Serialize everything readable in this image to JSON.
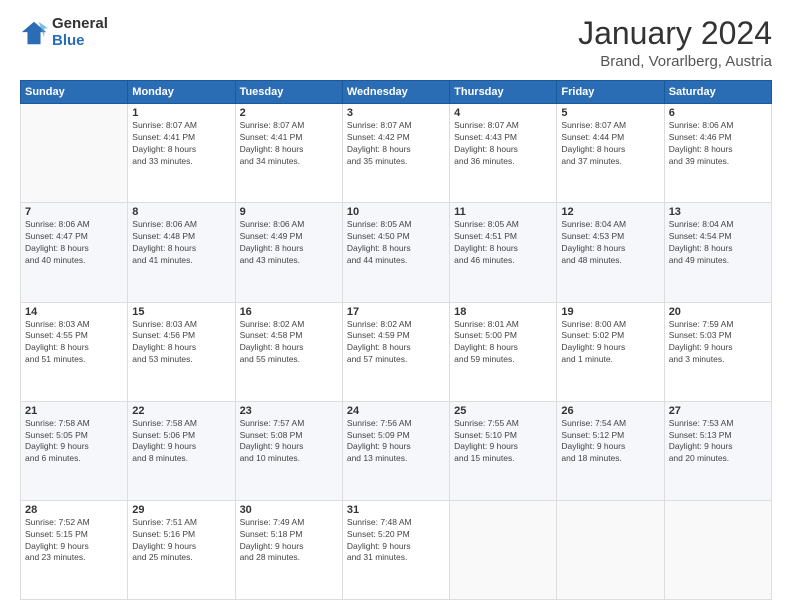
{
  "logo": {
    "general": "General",
    "blue": "Blue"
  },
  "header": {
    "month": "January 2024",
    "location": "Brand, Vorarlberg, Austria"
  },
  "weekdays": [
    "Sunday",
    "Monday",
    "Tuesday",
    "Wednesday",
    "Thursday",
    "Friday",
    "Saturday"
  ],
  "weeks": [
    [
      {
        "day": "",
        "info": ""
      },
      {
        "day": "1",
        "info": "Sunrise: 8:07 AM\nSunset: 4:41 PM\nDaylight: 8 hours\nand 33 minutes."
      },
      {
        "day": "2",
        "info": "Sunrise: 8:07 AM\nSunset: 4:41 PM\nDaylight: 8 hours\nand 34 minutes."
      },
      {
        "day": "3",
        "info": "Sunrise: 8:07 AM\nSunset: 4:42 PM\nDaylight: 8 hours\nand 35 minutes."
      },
      {
        "day": "4",
        "info": "Sunrise: 8:07 AM\nSunset: 4:43 PM\nDaylight: 8 hours\nand 36 minutes."
      },
      {
        "day": "5",
        "info": "Sunrise: 8:07 AM\nSunset: 4:44 PM\nDaylight: 8 hours\nand 37 minutes."
      },
      {
        "day": "6",
        "info": "Sunrise: 8:06 AM\nSunset: 4:46 PM\nDaylight: 8 hours\nand 39 minutes."
      }
    ],
    [
      {
        "day": "7",
        "info": "Sunrise: 8:06 AM\nSunset: 4:47 PM\nDaylight: 8 hours\nand 40 minutes."
      },
      {
        "day": "8",
        "info": "Sunrise: 8:06 AM\nSunset: 4:48 PM\nDaylight: 8 hours\nand 41 minutes."
      },
      {
        "day": "9",
        "info": "Sunrise: 8:06 AM\nSunset: 4:49 PM\nDaylight: 8 hours\nand 43 minutes."
      },
      {
        "day": "10",
        "info": "Sunrise: 8:05 AM\nSunset: 4:50 PM\nDaylight: 8 hours\nand 44 minutes."
      },
      {
        "day": "11",
        "info": "Sunrise: 8:05 AM\nSunset: 4:51 PM\nDaylight: 8 hours\nand 46 minutes."
      },
      {
        "day": "12",
        "info": "Sunrise: 8:04 AM\nSunset: 4:53 PM\nDaylight: 8 hours\nand 48 minutes."
      },
      {
        "day": "13",
        "info": "Sunrise: 8:04 AM\nSunset: 4:54 PM\nDaylight: 8 hours\nand 49 minutes."
      }
    ],
    [
      {
        "day": "14",
        "info": "Sunrise: 8:03 AM\nSunset: 4:55 PM\nDaylight: 8 hours\nand 51 minutes."
      },
      {
        "day": "15",
        "info": "Sunrise: 8:03 AM\nSunset: 4:56 PM\nDaylight: 8 hours\nand 53 minutes."
      },
      {
        "day": "16",
        "info": "Sunrise: 8:02 AM\nSunset: 4:58 PM\nDaylight: 8 hours\nand 55 minutes."
      },
      {
        "day": "17",
        "info": "Sunrise: 8:02 AM\nSunset: 4:59 PM\nDaylight: 8 hours\nand 57 minutes."
      },
      {
        "day": "18",
        "info": "Sunrise: 8:01 AM\nSunset: 5:00 PM\nDaylight: 8 hours\nand 59 minutes."
      },
      {
        "day": "19",
        "info": "Sunrise: 8:00 AM\nSunset: 5:02 PM\nDaylight: 9 hours\nand 1 minute."
      },
      {
        "day": "20",
        "info": "Sunrise: 7:59 AM\nSunset: 5:03 PM\nDaylight: 9 hours\nand 3 minutes."
      }
    ],
    [
      {
        "day": "21",
        "info": "Sunrise: 7:58 AM\nSunset: 5:05 PM\nDaylight: 9 hours\nand 6 minutes."
      },
      {
        "day": "22",
        "info": "Sunrise: 7:58 AM\nSunset: 5:06 PM\nDaylight: 9 hours\nand 8 minutes."
      },
      {
        "day": "23",
        "info": "Sunrise: 7:57 AM\nSunset: 5:08 PM\nDaylight: 9 hours\nand 10 minutes."
      },
      {
        "day": "24",
        "info": "Sunrise: 7:56 AM\nSunset: 5:09 PM\nDaylight: 9 hours\nand 13 minutes."
      },
      {
        "day": "25",
        "info": "Sunrise: 7:55 AM\nSunset: 5:10 PM\nDaylight: 9 hours\nand 15 minutes."
      },
      {
        "day": "26",
        "info": "Sunrise: 7:54 AM\nSunset: 5:12 PM\nDaylight: 9 hours\nand 18 minutes."
      },
      {
        "day": "27",
        "info": "Sunrise: 7:53 AM\nSunset: 5:13 PM\nDaylight: 9 hours\nand 20 minutes."
      }
    ],
    [
      {
        "day": "28",
        "info": "Sunrise: 7:52 AM\nSunset: 5:15 PM\nDaylight: 9 hours\nand 23 minutes."
      },
      {
        "day": "29",
        "info": "Sunrise: 7:51 AM\nSunset: 5:16 PM\nDaylight: 9 hours\nand 25 minutes."
      },
      {
        "day": "30",
        "info": "Sunrise: 7:49 AM\nSunset: 5:18 PM\nDaylight: 9 hours\nand 28 minutes."
      },
      {
        "day": "31",
        "info": "Sunrise: 7:48 AM\nSunset: 5:20 PM\nDaylight: 9 hours\nand 31 minutes."
      },
      {
        "day": "",
        "info": ""
      },
      {
        "day": "",
        "info": ""
      },
      {
        "day": "",
        "info": ""
      }
    ]
  ]
}
